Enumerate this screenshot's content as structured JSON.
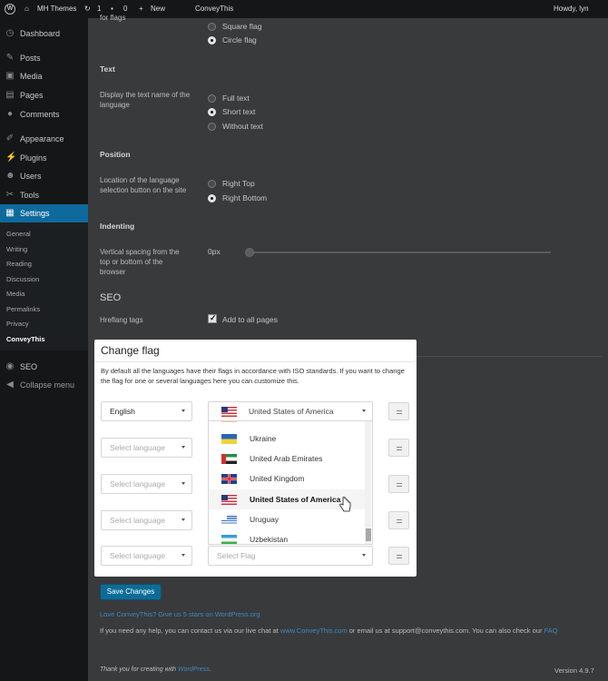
{
  "adminbar": {
    "site_name": "MH Themes",
    "updates_count": "1",
    "comments_count": "0",
    "new_label": "New",
    "plugin_label": "ConveyThis",
    "howdy": "Howdy, lyn"
  },
  "sidebar": {
    "items": [
      {
        "label": "Dashboard",
        "icon": "dashboard-icon"
      },
      {
        "label": "Posts",
        "icon": "pin-icon"
      },
      {
        "label": "Media",
        "icon": "media-icon"
      },
      {
        "label": "Pages",
        "icon": "pages-icon"
      },
      {
        "label": "Comments",
        "icon": "comment-icon"
      },
      {
        "label": "Appearance",
        "icon": "brush-icon"
      },
      {
        "label": "Plugins",
        "icon": "plug-icon"
      },
      {
        "label": "Users",
        "icon": "users-icon"
      },
      {
        "label": "Tools",
        "icon": "wrench-icon"
      },
      {
        "label": "Settings",
        "icon": "settings-icon"
      }
    ],
    "submenu": [
      "General",
      "Writing",
      "Reading",
      "Discussion",
      "Media",
      "Permalinks",
      "Privacy",
      "ConveyThis"
    ],
    "seo_label": "SEO",
    "collapse_label": "Collapse menu"
  },
  "settings": {
    "flags_label_partial": "for flags",
    "flag_options": [
      "Square flag",
      "Circle flag"
    ],
    "text_heading": "Text",
    "text_desc": "Display the text name of the language",
    "text_options": [
      "Full text",
      "Short text",
      "Without text"
    ],
    "position_heading": "Position",
    "position_desc": "Location of the language selection button on the site",
    "position_options": [
      "Right Top",
      "Right Bottom"
    ],
    "indent_heading": "Indenting",
    "indent_desc": "Vertical spacing from the top or bottom of the browser",
    "indent_value": "0px",
    "seo_heading": "SEO",
    "hreflang_label": "Hreflang tags",
    "hreflang_option": "Add to all pages"
  },
  "modal": {
    "title": "Change flag",
    "intro": "By default all the languages have their flags in accordance with ISO standards. If you want to change the flag for one or several languages here you can customize this.",
    "row1_language": "English",
    "row1_flag": "United States of America",
    "select_language_placeholder": "Select language",
    "select_flag_placeholder": "Select Flag",
    "dropdown_items": [
      {
        "name": "Ukraine",
        "flag": "ua"
      },
      {
        "name": "United Arab Emirates",
        "flag": "ae"
      },
      {
        "name": "United Kingdom",
        "flag": "uk"
      },
      {
        "name": "United States of America",
        "flag": "us"
      },
      {
        "name": "Uruguay",
        "flag": "uy"
      },
      {
        "name": "Uzbekistan",
        "flag": "uz"
      }
    ]
  },
  "footer": {
    "save_label": "Save Changes",
    "love_link": "Love ConveyThis? Give us 5 stars on WordPress.org",
    "help_prefix": "If you need any help, you can contact us via our live chat at ",
    "help_link1": "www.ConveyThis.com",
    "help_middle": " or email us at support@conveythis.com. You can also check our ",
    "help_link2": "FAQ",
    "thanks_prefix": "Thank you for creating with ",
    "thanks_link": "WordPress",
    "version": "Version 4.9.7"
  }
}
